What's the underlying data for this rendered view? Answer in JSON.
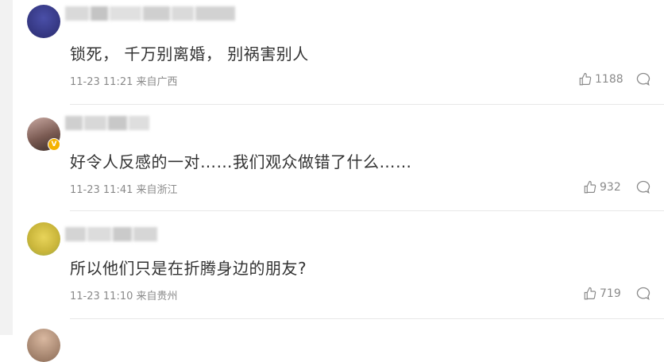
{
  "comments": [
    {
      "text": "锁死， 千万别离婚， 别祸害别人",
      "time": "11-23 11:21",
      "location": "来自广西",
      "likes": "1188"
    },
    {
      "text": "好令人反感的一对……我们观众做错了什么……",
      "time": "11-23 11:41",
      "location": "来自浙江",
      "likes": "932"
    },
    {
      "text": "所以他们只是在折腾身边的朋友?",
      "time": "11-23 11:10",
      "location": "来自贵州",
      "likes": "719"
    }
  ],
  "icons": {
    "like": "thumbs-up-icon",
    "reply": "comment-bubble-icon",
    "verified": "verified-badge-icon"
  },
  "colors": {
    "text": "#333333",
    "meta": "#8a8a8a",
    "verified": "#f5b200"
  }
}
